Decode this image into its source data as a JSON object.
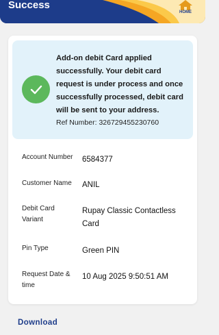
{
  "header": {
    "title": "Success",
    "home_label": "HOME",
    "colors": {
      "primary": "#1d3c8a",
      "accent": "#f5a623"
    }
  },
  "status": {
    "message": "Add-on debit Card applied successfully. Your debit card request is under process and once successfully processed, debit card will be sent to your address.",
    "ref_label": "Ref Number:",
    "ref_number": "326729455230760",
    "icon": "check-icon",
    "icon_color": "#5cb85c"
  },
  "details": [
    {
      "label": "Account Number",
      "value": "6584377"
    },
    {
      "label": "Customer Name",
      "value": "ANIL"
    },
    {
      "label": "Debit Card Variant",
      "value": "Rupay Classic Contactless Card"
    },
    {
      "label": "Pin Type",
      "value": "Green PIN"
    },
    {
      "label": "Request Date & time",
      "value": "10 Aug 2025 9:50:51 AM"
    }
  ],
  "actions": {
    "download_label": "Download"
  }
}
